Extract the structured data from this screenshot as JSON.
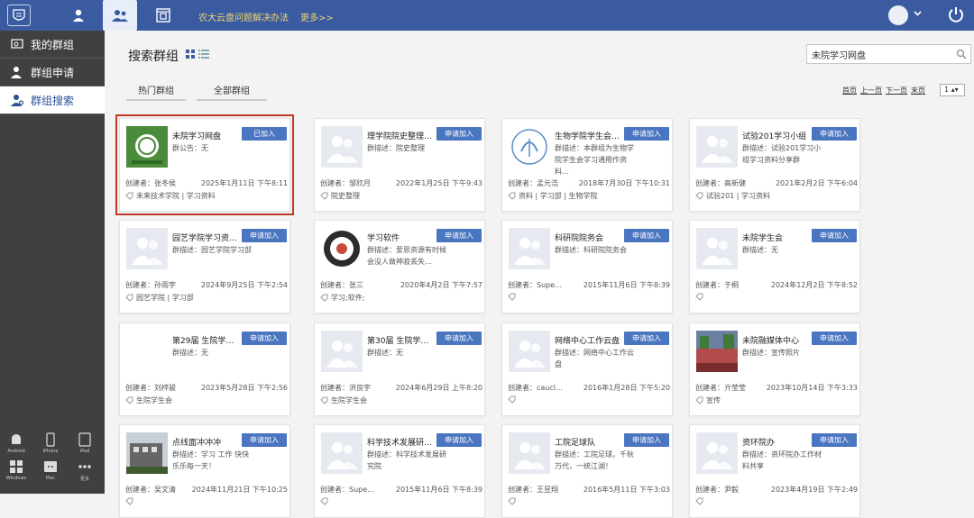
{
  "header": {
    "help_link": "农大云盘问题解决办法",
    "more_link": "更多>>"
  },
  "sidebar": {
    "items": [
      {
        "label": "我的群组"
      },
      {
        "label": "群组申请"
      },
      {
        "label": "群组搜索"
      }
    ]
  },
  "platforms": [
    "Android",
    "iPhone",
    "iPad",
    "Windows",
    "Mac",
    "更多"
  ],
  "main": {
    "title": "搜索群组",
    "search_value": "未院学习网盘",
    "tabs": [
      "热门群组",
      "全部群组"
    ],
    "pager": [
      "首页",
      "上一页",
      "下一页",
      "末页"
    ],
    "page_select": "1"
  },
  "cards": [
    {
      "name": "未院学习网盘",
      "btn": "已加入",
      "desc": "群公告：无",
      "creator": "创建者：张冬侯",
      "date": "2025年1月11日 下午8:11",
      "tags": "未来技术学院 | 学习资料",
      "thumb": "logo-green"
    },
    {
      "name": "理学院院史整理…",
      "btn": "申请加入",
      "desc": "群描述：院史整理",
      "creator": "创建者：邹欣月",
      "date": "2022年1月25日 下午9:43",
      "tags": "院史整理",
      "thumb": "placeholder"
    },
    {
      "name": "生物学院学生会…",
      "btn": "申请加入",
      "desc": "群描述：本群组为生物学院学生会学习通用作资料…",
      "creator": "创建者：孟元浩",
      "date": "2018年7月30日 下午10:31",
      "tags": "资料 | 学习部 | 生物学院",
      "thumb": "logo-blue"
    },
    {
      "name": "试验201学习小组",
      "btn": "申请加入",
      "desc": "群描述：试验201学习小组学习资料分享群",
      "creator": "创建者：高新健",
      "date": "2021年2月2日 下午6:04",
      "tags": "试验201 | 学习资料",
      "thumb": "placeholder"
    },
    {
      "name": "园艺学院学习资…",
      "btn": "申请加入",
      "desc": "群描述：园艺学院学习部",
      "creator": "创建者：孙雨宇",
      "date": "2024年9月25日 下午2:54",
      "tags": "园艺学院 | 学习部",
      "thumb": "placeholder"
    },
    {
      "name": "学习软件",
      "btn": "申请加入",
      "desc": "群描述：爱思资源有时候会没人做神寂丢失…",
      "creator": "创建者：张三",
      "date": "2020年4月2日 下午7:57",
      "tags": "学习;软件;",
      "thumb": "logo-dark"
    },
    {
      "name": "科研院院务会",
      "btn": "申请加入",
      "desc": "群描述：科研院院务会",
      "creator": "创建者：Supe…",
      "date": "2015年11月6日 下午8:39",
      "tags": "",
      "thumb": "placeholder"
    },
    {
      "name": "未院学生会",
      "btn": "申请加入",
      "desc": "群描述：无",
      "creator": "创建者：于桐",
      "date": "2024年12月2日 下午8:52",
      "tags": "",
      "thumb": "placeholder"
    },
    {
      "name": "第29届 生院学…",
      "btn": "申请加入",
      "desc": "群描述：无",
      "creator": "创建者：刘梓骏",
      "date": "2023年5月28日 下午2:56",
      "tags": "生院学生会",
      "thumb": "blank"
    },
    {
      "name": "第30届 生院学…",
      "btn": "申请加入",
      "desc": "群描述：无",
      "creator": "创建者：洪良宇",
      "date": "2024年6月29日 上午8:20",
      "tags": "生院学生会",
      "thumb": "placeholder"
    },
    {
      "name": "网络中心工作云盘",
      "btn": "申请加入",
      "desc": "群描述：网络中心工作云盘",
      "creator": "创建者：caucl…",
      "date": "2016年1月28日 下午5:20",
      "tags": "",
      "thumb": "placeholder"
    },
    {
      "name": "未院融媒体中心",
      "btn": "申请加入",
      "desc": "群描述：宣传照片",
      "creator": "创建者：亓莹莹",
      "date": "2023年10月14日 下午3:33",
      "tags": "宣传",
      "thumb": "photo-crowd"
    },
    {
      "name": "点线面冲冲冲",
      "btn": "申请加入",
      "desc": "群描述：学习 工作 快快乐乐每一天！",
      "creator": "创建者：吴文清",
      "date": "2024年11月21日 下午10:25",
      "tags": "",
      "thumb": "photo-building"
    },
    {
      "name": "科学技术发展研…",
      "btn": "申请加入",
      "desc": "群描述：科学技术发展研究院",
      "creator": "创建者：Supe…",
      "date": "2015年11月6日 下午8:39",
      "tags": "",
      "thumb": "placeholder"
    },
    {
      "name": "工院足球队",
      "btn": "申请加入",
      "desc": "群描述：工院足球。千秋万代，一统江湖！",
      "creator": "创建者：王昱翔",
      "date": "2016年5月11日 下午3:03",
      "tags": "",
      "thumb": "placeholder"
    },
    {
      "name": "资环院办",
      "btn": "申请加入",
      "desc": "群描述：资环院办工作材料共享",
      "creator": "创建者：尹毅",
      "date": "2023年4月19日 下午2:49",
      "tags": "",
      "thumb": "placeholder"
    }
  ],
  "colors": {
    "topbar": "#3a5ba0",
    "sidebar": "#404040",
    "button": "#4a75c0",
    "selected_outline": "#c0392b"
  }
}
